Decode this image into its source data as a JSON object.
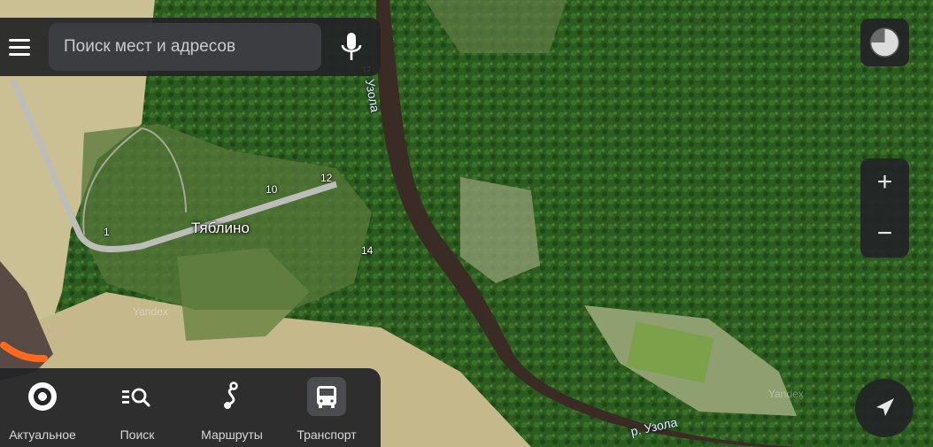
{
  "search": {
    "placeholder": "Поиск мест и адресов"
  },
  "map": {
    "village_name": "Тяблино",
    "river_label_north": "р. Узола",
    "river_label_south": "р. Узола",
    "house_numbers": [
      "1",
      "10",
      "12",
      "14"
    ],
    "watermarks": [
      "Yandex",
      "Yandex"
    ]
  },
  "controls": {
    "zoom_in": "+",
    "zoom_out": "−"
  },
  "tabs": [
    {
      "label": "Актуальное",
      "icon": "target-icon"
    },
    {
      "label": "Поиск",
      "icon": "list-search-icon"
    },
    {
      "label": "Маршруты",
      "icon": "route-icon"
    },
    {
      "label": "Транспорт",
      "icon": "bus-icon"
    }
  ],
  "colors": {
    "panel": "#222427",
    "forest": "#2b5a1e",
    "river": "#3a2b24",
    "field": "#cfc49b",
    "road_marker": "#ff6a1f"
  }
}
